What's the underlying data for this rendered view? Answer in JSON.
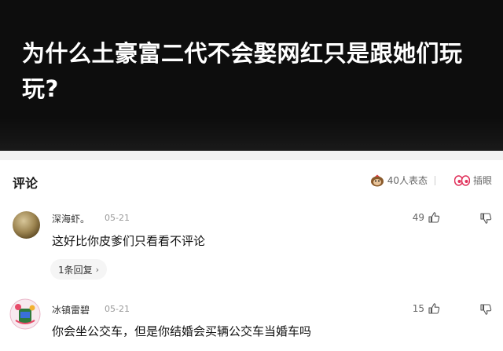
{
  "question": {
    "title": "为什么土豪富二代不会娶网红只是跟她们玩玩?"
  },
  "comments_header": {
    "title": "评论",
    "reactions_label": "40人表态",
    "eyes_label": "插眼"
  },
  "comments": [
    {
      "username": "深海虾。",
      "date": "05-21",
      "likes": "49",
      "text": "这好比你皮爹们只看看不评论",
      "reply_label": "1条回复"
    },
    {
      "username": "冰镇雷碧",
      "date": "05-21",
      "likes": "15",
      "text": "你会坐公交车，但是你结婚会买辆公交车当婚车吗"
    }
  ],
  "icons": {
    "reaction": "monkey-reaction-icon",
    "eyes": "eyes-icon",
    "like": "thumbs-up-icon",
    "dislike": "thumbs-down-icon"
  }
}
